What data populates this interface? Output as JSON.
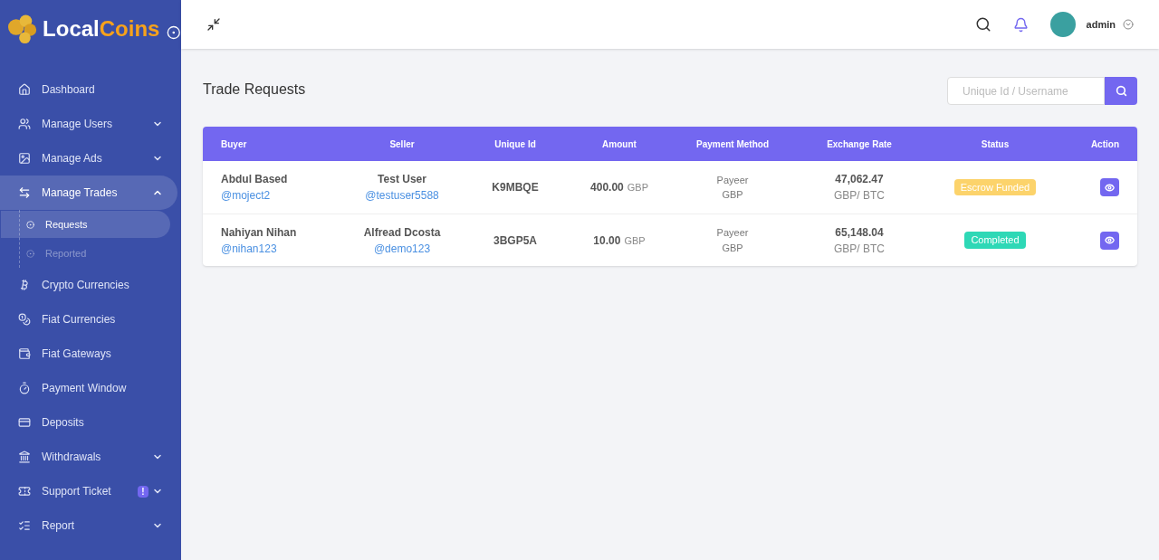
{
  "brand": {
    "first": "Local",
    "second": "Coins"
  },
  "sidebar": {
    "items": [
      {
        "label": "Dashboard",
        "selected": false
      },
      {
        "label": "Manage Users",
        "expanded": false,
        "selected": false
      },
      {
        "label": "Manage Ads",
        "expanded": false,
        "selected": false
      },
      {
        "label": "Manage Trades",
        "expanded": true,
        "selected": true,
        "children": [
          {
            "label": "Requests",
            "selected": true
          },
          {
            "label": "Reported",
            "selected": false
          }
        ]
      },
      {
        "label": "Crypto Currencies",
        "selected": false
      },
      {
        "label": "Fiat Currencies",
        "selected": false
      },
      {
        "label": "Fiat Gateways",
        "selected": false
      },
      {
        "label": "Payment Window",
        "selected": false
      },
      {
        "label": "Deposits",
        "selected": false
      },
      {
        "label": "Withdrawals",
        "expanded": false,
        "selected": false
      },
      {
        "label": "Support Ticket",
        "expanded": false,
        "selected": false,
        "badge": "!"
      },
      {
        "label": "Report",
        "expanded": false,
        "selected": false
      }
    ]
  },
  "topbar": {
    "user": "admin"
  },
  "page": {
    "title": "Trade Requests",
    "search": {
      "placeholder": "Unique Id / Username"
    }
  },
  "table": {
    "columns": [
      "Buyer",
      "Seller",
      "Unique Id",
      "Amount",
      "Payment Method",
      "Exchange Rate",
      "Status",
      "Action"
    ],
    "rows": [
      {
        "buyer": "Abdul Based",
        "buyer_handle": "@moject2",
        "seller": "Test User",
        "seller_handle": "@testuser5588",
        "id": "K9MBQE",
        "amount": "400.00",
        "amount_currency": "GBP",
        "method": "Payeer",
        "method_currency": "GBP",
        "rate": "47,062.47",
        "rate_unit": "GBP/ BTC",
        "status": "Escrow Funded",
        "color": "#fcd36b"
      },
      {
        "buyer": "Nahiyan Nihan",
        "buyer_handle": "@nihan123",
        "seller": "Alfread Dcosta",
        "seller_handle": "@demo123",
        "id": "3BGP5A",
        "amount": "10.00",
        "amount_currency": "GBP",
        "method": "Payeer",
        "method_currency": "GBP",
        "rate": "65,148.04",
        "rate_unit": "GBP/ BTC",
        "status": "Completed",
        "color": "#2ed8b6"
      }
    ]
  }
}
